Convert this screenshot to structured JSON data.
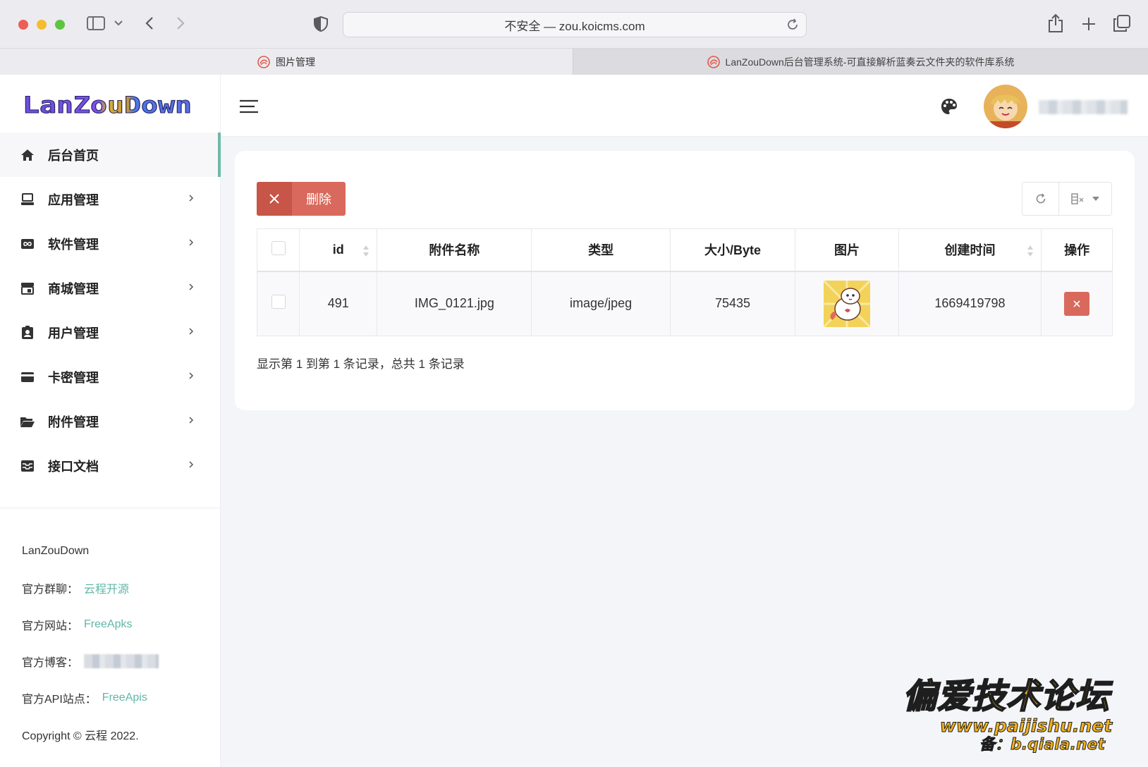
{
  "browser": {
    "url_text": "不安全 — zou.koicms.com",
    "tabs": [
      {
        "label": "图片管理",
        "active": true
      },
      {
        "label": "LanZouDown后台管理系统-可直接解析蓝奏云文件夹的软件库系统",
        "active": false
      }
    ]
  },
  "sidebar": {
    "logo_text": "LanZouDown",
    "items": [
      {
        "label": "后台首页",
        "icon": "home-icon",
        "active": true
      },
      {
        "label": "应用管理",
        "icon": "laptop-icon"
      },
      {
        "label": "软件管理",
        "icon": "infinity-icon"
      },
      {
        "label": "商城管理",
        "icon": "store-icon"
      },
      {
        "label": "用户管理",
        "icon": "user-badge-icon"
      },
      {
        "label": "卡密管理",
        "icon": "credit-card-icon"
      },
      {
        "label": "附件管理",
        "icon": "folder-open-icon"
      },
      {
        "label": "接口文档",
        "icon": "inbox-icon"
      }
    ],
    "footer": {
      "brand": "LanZouDown",
      "group_label": "官方群聊：",
      "group_link": "云程开源",
      "site_label": "官方网站：",
      "site_link": "FreeApks",
      "blog_label": "官方博客：",
      "api_label": "官方API站点：",
      "api_link": "FreeApis",
      "copyright": "Copyright © 云程 2022."
    }
  },
  "toolbar": {
    "delete_label": "删除"
  },
  "table": {
    "columns": [
      "id",
      "附件名称",
      "类型",
      "大小/Byte",
      "图片",
      "创建时间",
      "操作"
    ],
    "rows": [
      {
        "id": "491",
        "name": "IMG_0121.jpg",
        "type": "image/jpeg",
        "size": "75435",
        "created": "1669419798"
      }
    ]
  },
  "pagination": {
    "info": "显示第 1 到第 1 条记录，总共 1 条记录"
  },
  "watermark": {
    "title": "偏爱技术论坛",
    "url": "www.paijishu.net",
    "icp": "备：b.qiala.net"
  },
  "colors": {
    "accent": "#6fb9a7",
    "danger": "#d9695d",
    "link": "#5fb7a8"
  }
}
